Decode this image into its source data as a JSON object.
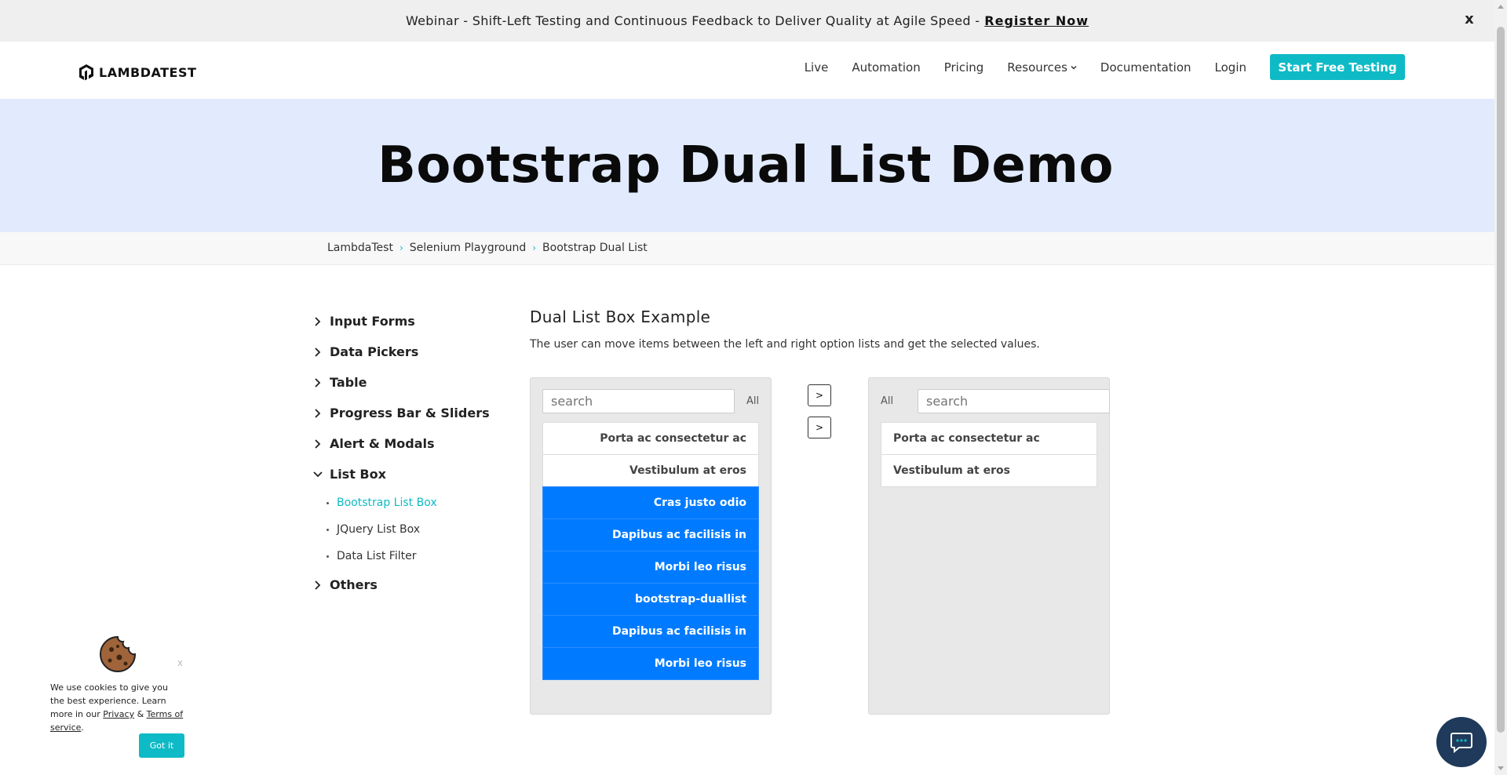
{
  "banner": {
    "text": "Webinar - Shift-Left Testing and Continuous Feedback to Deliver Quality at Agile Speed -",
    "link": "Register Now",
    "close": "x"
  },
  "navbar": {
    "logo": "LAMBDATEST",
    "links": [
      "Live",
      "Automation",
      "Pricing",
      "Resources",
      "Documentation",
      "Login"
    ],
    "cta": "Start Free Testing"
  },
  "hero": {
    "title": "Bootstrap Dual List Demo"
  },
  "breadcrumb": [
    "LambdaTest",
    "Selenium Playground",
    "Bootstrap Dual List"
  ],
  "sidebar": {
    "categories": [
      "Input Forms",
      "Data Pickers",
      "Table",
      "Progress Bar & Sliders",
      "Alert & Modals",
      "List Box",
      "Others"
    ],
    "listbox_items": [
      "Bootstrap List Box",
      "JQuery List Box",
      "Data List Filter"
    ]
  },
  "main": {
    "title": "Dual List Box Example",
    "description": "The user can move items between the left and right option lists and get the selected values."
  },
  "left_list": {
    "placeholder": "search",
    "all_label": "All",
    "items": [
      {
        "label": "Porta ac consectetur ac",
        "selected": false
      },
      {
        "label": "Vestibulum at eros",
        "selected": false
      },
      {
        "label": "Cras justo odio",
        "selected": true
      },
      {
        "label": "Dapibus ac facilisis in",
        "selected": true
      },
      {
        "label": "Morbi leo risus",
        "selected": true
      },
      {
        "label": "bootstrap-duallist",
        "selected": true
      },
      {
        "label": "Dapibus ac facilisis in",
        "selected": true
      },
      {
        "label": "Morbi leo risus",
        "selected": true
      }
    ]
  },
  "move_buttons": [
    ">",
    ">"
  ],
  "right_list": {
    "placeholder": "search",
    "all_label": "All",
    "items": [
      {
        "label": "Porta ac consectetur ac",
        "selected": false
      },
      {
        "label": "Vestibulum at eros",
        "selected": false
      }
    ]
  },
  "cookie": {
    "close": "x",
    "text_before": "We use cookies to give you the best experience. Learn more in our",
    "privacy": "Privacy",
    "amp": "&",
    "terms": "Terms of service",
    "period": ".",
    "button": "Got it"
  },
  "colors": {
    "accent": "#0ebac5",
    "selected_item": "#007bff",
    "hero_bg": "#e2ebfd",
    "chat_bg": "#1f3a5a"
  }
}
